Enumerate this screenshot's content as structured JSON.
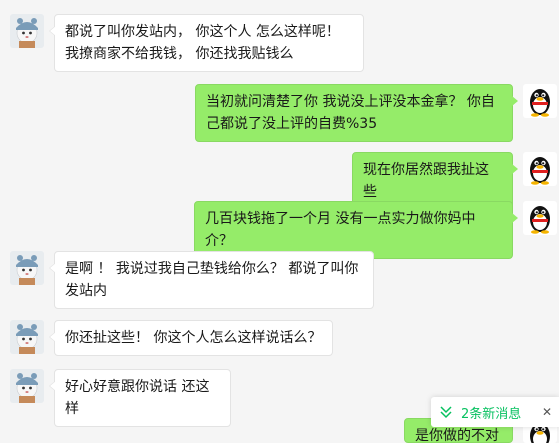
{
  "messages": [
    {
      "side": "in",
      "text": "都说了叫你发站内， 你这个人 怎么这样呢！ 我撩商家不给我钱， 你还找我贴钱么"
    },
    {
      "side": "out",
      "text": "当初就问清楚了你 我说没上评没本金拿？ 你自己都说了没上评的自费%35"
    },
    {
      "side": "out",
      "text": "现在你居然跟我扯这些"
    },
    {
      "side": "out",
      "text": "几百块钱拖了一个月 没有一点实力做你妈中介？"
    },
    {
      "side": "in",
      "text": "是啊 ！ 我说过我自己垫钱给你么？ 都说了叫你发站内"
    },
    {
      "side": "in",
      "text": "你还扯这些！ 你这个人怎么这样说话么？"
    },
    {
      "side": "in",
      "text": "好心好意跟你说话 还这样"
    },
    {
      "side": "out",
      "text": "是你做的不对"
    }
  ],
  "new_messages": {
    "label": "2条新消息",
    "close": "✕"
  },
  "icons": {
    "self_avatar": "penguin-avatar-icon",
    "other_avatar": "cartoon-avatar-icon",
    "scroll_down": "double-chevron-down-icon"
  },
  "colors": {
    "incoming_bubble": "#ffffff",
    "outgoing_bubble": "#95ec69",
    "accent": "#07c160",
    "background": "#f5f5f5"
  }
}
